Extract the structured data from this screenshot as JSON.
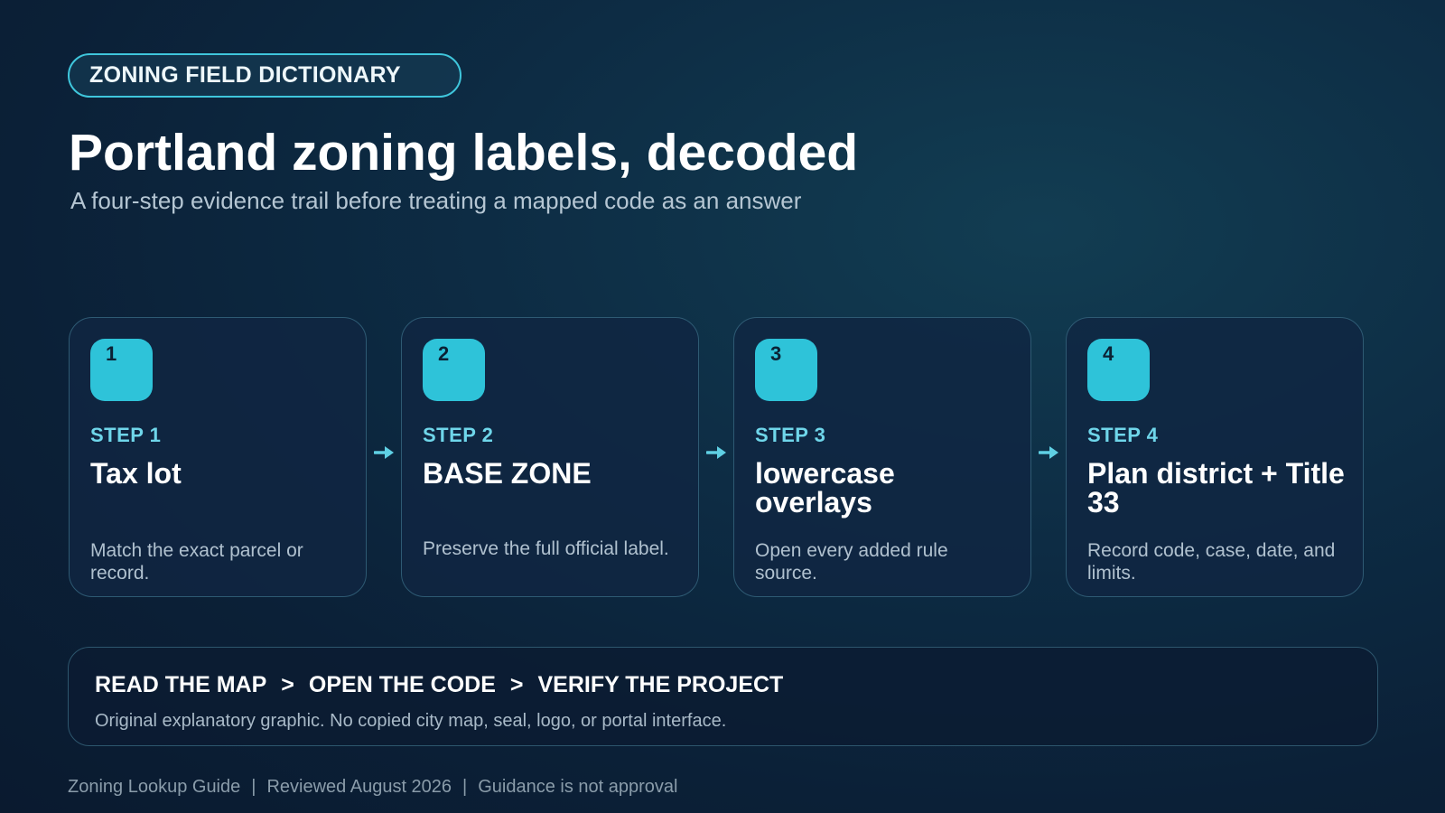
{
  "header": {
    "pill_label": "ZONING FIELD DICTIONARY",
    "title": "Portland zoning labels, decoded",
    "subtitle": "A four-step evidence trail before treating a mapped code as an answer"
  },
  "steps": [
    {
      "number": "1",
      "step_label": "STEP 1",
      "title": "Tax lot",
      "description": "Match the exact parcel or record."
    },
    {
      "number": "2",
      "step_label": "STEP 2",
      "title": "BASE ZONE",
      "description": "Preserve the full official label."
    },
    {
      "number": "3",
      "step_label": "STEP 3",
      "title": "lowercase overlays",
      "description": "Open every added rule source."
    },
    {
      "number": "4",
      "step_label": "STEP 4",
      "title": "Plan district + Title 33",
      "description": "Record code, case, date, and limits."
    }
  ],
  "flow": {
    "items": [
      "READ THE MAP",
      "OPEN THE CODE",
      "VERIFY THE PROJECT"
    ],
    "separator": ">",
    "note": "Original explanatory graphic. No copied city map, seal, logo, or portal interface."
  },
  "footer": {
    "items": [
      "Zoning Lookup Guide",
      "Reviewed August 2026",
      "Guidance is not approval"
    ],
    "separator": "|"
  },
  "colors": {
    "accent": "#2ec3d9",
    "step_label": "#6fd6ea",
    "pill_border": "#3fc6dc"
  },
  "icons": {
    "connector": "arrow-right-icon"
  }
}
